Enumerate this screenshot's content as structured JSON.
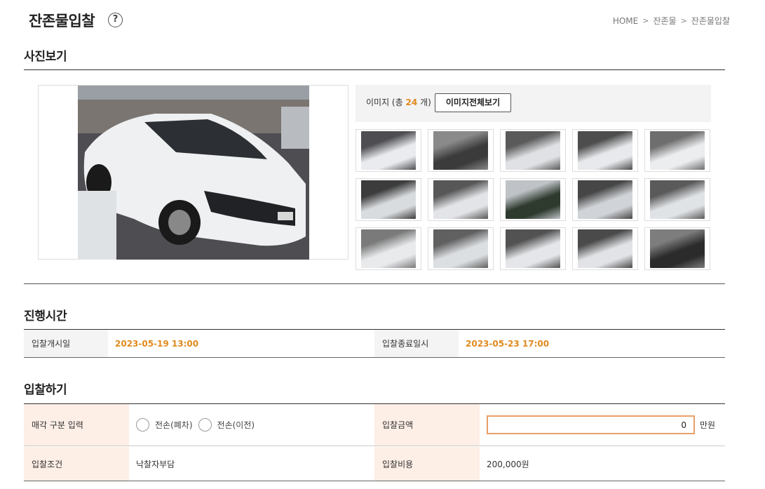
{
  "header": {
    "title": "잔존물입찰",
    "help_icon": "question-circle-icon",
    "breadcrumb": [
      "HOME",
      "잔존물",
      "잔존물입찰"
    ]
  },
  "photos": {
    "section_title": "사진보기",
    "image_label_prefix": "이미지 (총",
    "image_count": "24",
    "image_label_suffix": "개)",
    "view_all_button": "이미지전체보기",
    "thumbnails": [
      "car-front-left-icon",
      "car-interior-icon",
      "car-front-icon",
      "car-front-left-damage-icon",
      "car-rear-icon",
      "car-hood-icon",
      "car-hood-closeup-icon",
      "car-grille-icon",
      "car-front-plate-icon",
      "car-fender-icon",
      "car-panel-icon",
      "car-bumper-icon",
      "car-headlight-icon",
      "car-headlight-right-icon",
      "car-interior-dark-icon"
    ]
  },
  "schedule": {
    "section_title": "진행시간",
    "start_label": "입찰개시일",
    "start_value": "2023-05-19 13:00",
    "end_label": "입찰종료일시",
    "end_value": "2023-05-23 17:00"
  },
  "bid": {
    "section_title": "입찰하기",
    "sale_type_label": "매각 구분 입력",
    "options": [
      "전손(폐차)",
      "전손(이전)"
    ],
    "amount_label": "입찰금액",
    "amount_value": "0",
    "amount_unit": "만원",
    "condition_label": "입찰조건",
    "condition_value": "낙찰자부담",
    "cost_label": "입찰비용",
    "cost_value": "200,000원"
  },
  "colors": {
    "accent": "#e08a1e",
    "peach": "#fdeee6",
    "input_border": "#e8a06a"
  }
}
